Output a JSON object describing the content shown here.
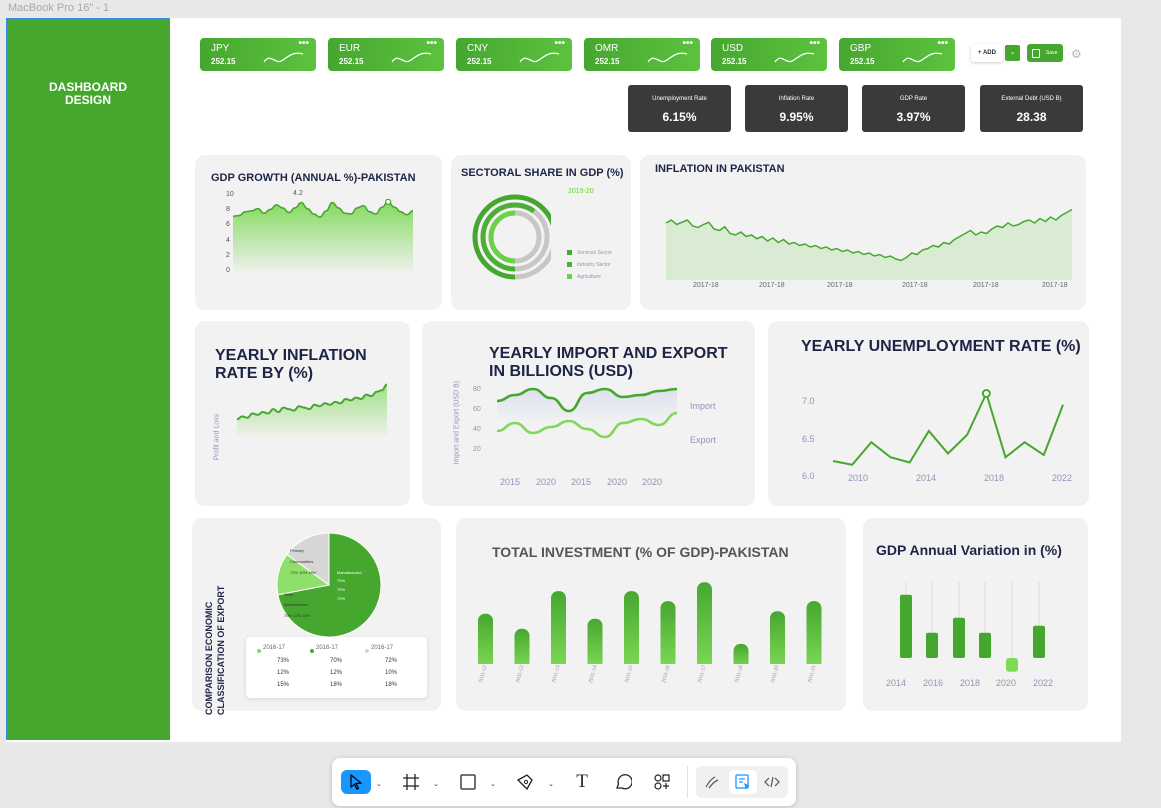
{
  "frame": {
    "label": "MacBook Pro 16\" - 1"
  },
  "sidebar": {
    "title": "DASHBOARD\nDESIGN"
  },
  "currencies": [
    {
      "code": "JPY",
      "value": "252.15"
    },
    {
      "code": "EUR",
      "value": "252.15"
    },
    {
      "code": "CNY",
      "value": "252.15"
    },
    {
      "code": "OMR",
      "value": "252.15"
    },
    {
      "code": "USD",
      "value": "252.15"
    },
    {
      "code": "GBP",
      "value": "252.15"
    }
  ],
  "actions": {
    "add_label": "+ ADD",
    "save_label": "Save",
    "chevron": "⌄",
    "dots": "•••"
  },
  "kpis": [
    {
      "label": "Unemployment Rate",
      "value": "6.15%"
    },
    {
      "label": "Inflation Rate",
      "value": "9.95%"
    },
    {
      "label": "GDP Rate",
      "value": "3.97%"
    },
    {
      "label": "External Debt (USD B)",
      "value": "28.38"
    }
  ],
  "colors": {
    "brand": "#46a72f",
    "brand_light": "#7ed957",
    "kpi_bg": "#3a3a3a",
    "accent_blue": "#1797ff"
  },
  "chart_data": [
    {
      "type": "area",
      "title": "GDP GROWTH (ANNUAL %)-PAKISTAN",
      "y_ticks": [
        "10",
        "8",
        "6",
        "4",
        "2",
        "0"
      ],
      "ylim": [
        0,
        10
      ],
      "annotation": "4.2",
      "values": [
        7.2,
        7.3,
        7.8,
        7.9,
        8.2,
        7.6,
        8.1,
        8.7,
        8.3,
        7.7,
        8.3,
        9.0,
        8.2,
        7.5,
        7.1,
        7.9,
        9.0,
        8.3,
        7.6,
        7.5,
        8.3,
        8.6,
        7.8,
        7.5,
        8.4,
        9.1,
        8.4,
        7.8,
        7.4,
        7.9
      ]
    },
    {
      "type": "pie",
      "title": "SECTORAL SHARE IN GDP (%)",
      "year_label": "2019-20",
      "series": [
        {
          "name": "Services Sector",
          "value": 60
        },
        {
          "name": "Industry Sector",
          "value": 20
        },
        {
          "name": "Agriculture",
          "value": 20
        }
      ]
    },
    {
      "type": "area",
      "title": "INFLATION IN PAKISTAN",
      "x_ticks": [
        "2017-18",
        "2017-18",
        "2017-18",
        "2017-18",
        "2017-18",
        "2017-18"
      ],
      "values": [
        76,
        80,
        74,
        77,
        80,
        72,
        70,
        74,
        77,
        68,
        66,
        71,
        62,
        60,
        64,
        58,
        60,
        55,
        58,
        52,
        56,
        50,
        54,
        48,
        50,
        46,
        48,
        44,
        46,
        42,
        44,
        40,
        42,
        38,
        40,
        36,
        38,
        34,
        36,
        32,
        34,
        30,
        32,
        28,
        26,
        30,
        36,
        34,
        40,
        42,
        46,
        44,
        50,
        48,
        54,
        58,
        62,
        66,
        60,
        64,
        62,
        68,
        72,
        70,
        76,
        72,
        74,
        78,
        80,
        76,
        82,
        78,
        84,
        80,
        86,
        90,
        94
      ]
    },
    {
      "type": "area",
      "title": "YEARLY INFLATION RATE BY (%)",
      "ylabel": "Profit and Loss",
      "values": [
        30,
        34,
        32,
        38,
        36,
        40,
        38,
        44,
        40,
        46,
        44,
        42,
        48,
        46,
        44,
        50,
        48,
        52,
        50,
        54,
        52,
        58,
        56,
        60,
        58,
        64,
        62,
        68,
        70,
        78
      ]
    },
    {
      "type": "line",
      "title": "YEARLY IMPORT AND EXPORT IN BILLIONS (USD)",
      "ylabel": "Import and Export (USD B)",
      "y_ticks": [
        "80",
        "60",
        "40",
        "20"
      ],
      "ylim": [
        15,
        90
      ],
      "x_ticks": [
        "2015",
        "2020",
        "2015",
        "2020",
        "2020"
      ],
      "series": [
        {
          "name": "Import",
          "values": [
            70,
            76,
            82,
            73,
            60,
            78,
            82,
            74,
            76,
            80,
            82
          ]
        },
        {
          "name": "Export",
          "values": [
            40,
            48,
            38,
            44,
            50,
            42,
            34,
            48,
            52,
            46,
            58
          ]
        }
      ]
    },
    {
      "type": "line",
      "title": "YEARLY UNEMPLOYMENT RATE (%)",
      "y_ticks": [
        "7.0",
        "6.5",
        "6.0"
      ],
      "ylim": [
        6.0,
        7.2
      ],
      "x_ticks": [
        "2010",
        "2014",
        "2018",
        "2022"
      ],
      "values": [
        6.2,
        6.15,
        6.45,
        6.25,
        6.18,
        6.6,
        6.3,
        6.55,
        7.1,
        6.25,
        6.45,
        6.28,
        6.95
      ],
      "highlight_index": 8
    },
    {
      "type": "pie",
      "title": "COMPARISON ECONOMIC CLASSIFICATION OF EXPORT",
      "slices": [
        {
          "name": "Manufactured",
          "value": 72,
          "labels": [
            "70%",
            "70%",
            "72%"
          ]
        },
        {
          "name": "Semi Manufactured",
          "value": 13,
          "labels": [
            "70%",
            "12%",
            "10%"
          ]
        },
        {
          "name": "Primary Commodities",
          "value": 15,
          "labels": [
            "72%",
            "10%",
            "18%"
          ]
        }
      ],
      "table": {
        "headers": [
          "2016-17",
          "2016-17",
          "2016-17"
        ],
        "rows": [
          [
            "73%",
            "70%",
            "72%"
          ],
          [
            "12%",
            "12%",
            "10%"
          ],
          [
            "15%",
            "18%",
            "18%"
          ]
        ]
      }
    },
    {
      "type": "bar",
      "title": "TOTAL INVESTMENT (% OF GDP)-PAKISTAN",
      "categories": [
        "2011-12",
        "2011-12",
        "2011-13",
        "2011-14",
        "2011-15",
        "2011-16",
        "2011-17",
        "2011-18",
        "2011-20",
        "2011-21"
      ],
      "values": [
        40,
        28,
        58,
        36,
        58,
        50,
        65,
        16,
        42,
        50
      ]
    },
    {
      "type": "bar",
      "title": "GDP Annual Variation in (%)",
      "categories": [
        "2014",
        "2016",
        "2018",
        "2020",
        "2022"
      ],
      "values": [
        5.5,
        2.2,
        3.5,
        2.2,
        -1.2,
        2.8
      ],
      "x_ticks": [
        "2014",
        "2016",
        "2018",
        "2020",
        "2022"
      ]
    }
  ],
  "toolbar": {
    "tools": [
      "move",
      "frame",
      "shape",
      "pen",
      "text",
      "comment",
      "actions",
      "draw",
      "dev-annotate",
      "dev-mode"
    ],
    "text_glyph": "T"
  }
}
